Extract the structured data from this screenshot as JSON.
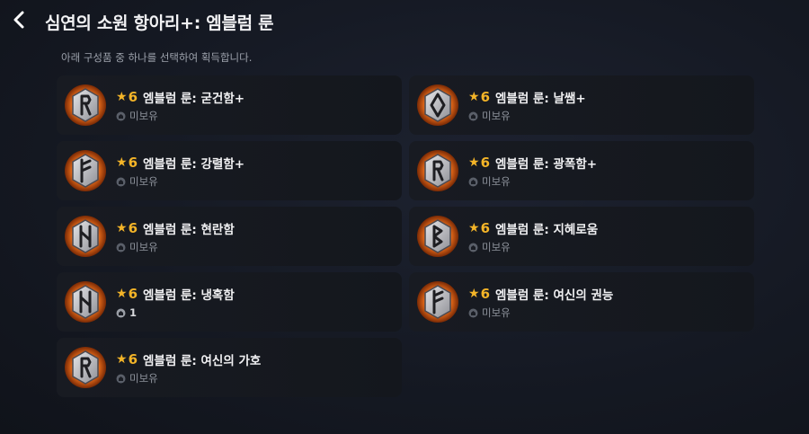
{
  "header": {
    "title": "심연의 소원 항아리+: 엠블럼 룬",
    "subtitle": "아래 구성품 중 하나를 선택하여 획득합니다."
  },
  "colors": {
    "accent_gold": "#f3b428",
    "glow_orange": "#ff7a1f"
  },
  "items": [
    {
      "star": "★",
      "grade": "6",
      "name": "엠블럼 룬: 굳건함+",
      "owned": "미보유",
      "rune_icon": "rune-r-icon"
    },
    {
      "star": "★",
      "grade": "6",
      "name": "엠블럼 룬: 날쌤+",
      "owned": "미보유",
      "rune_icon": "rune-diamond-icon"
    },
    {
      "star": "★",
      "grade": "6",
      "name": "엠블럼 룬: 강렬함+",
      "owned": "미보유",
      "rune_icon": "rune-f-icon"
    },
    {
      "star": "★",
      "grade": "6",
      "name": "엠블럼 룬: 광폭함+",
      "owned": "미보유",
      "rune_icon": "rune-r-icon"
    },
    {
      "star": "★",
      "grade": "6",
      "name": "엠블럼 룬: 현란함",
      "owned": "미보유",
      "rune_icon": "rune-n-icon"
    },
    {
      "star": "★",
      "grade": "6",
      "name": "엠블럼 룬: 지혜로움",
      "owned": "미보유",
      "rune_icon": "rune-b-icon"
    },
    {
      "star": "★",
      "grade": "6",
      "name": "엠블럼 룬: 냉혹함",
      "owned": "1",
      "rune_icon": "rune-n-icon"
    },
    {
      "star": "★",
      "grade": "6",
      "name": "엠블럼 룬: 여신의 권능",
      "owned": "미보유",
      "rune_icon": "rune-f-icon"
    },
    {
      "star": "★",
      "grade": "6",
      "name": "엠블럼 룬: 여신의 가호",
      "owned": "미보유",
      "rune_icon": "rune-r-icon"
    }
  ]
}
